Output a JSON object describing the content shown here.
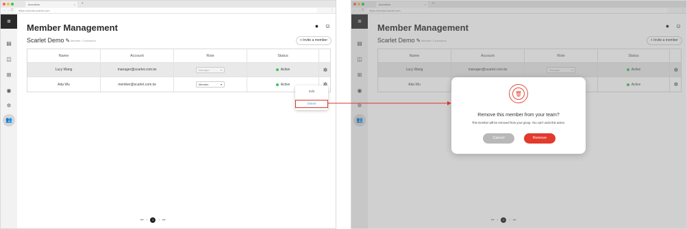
{
  "browser": {
    "tab_title": "docmArts",
    "tab_close": "×",
    "new_tab": "+",
    "url": "https://vendor.scarlet.com",
    "nav_back": "←",
    "nav_forward": "→",
    "nav_reload": "C",
    "menu": "⋮",
    "dot_colors": [
      "#ff5f57",
      "#febc2e",
      "#28c840"
    ]
  },
  "sidebar": {
    "menu_icon": "≡",
    "items": [
      {
        "icon": "documents-icon",
        "glyph": "▤"
      },
      {
        "icon": "dashboard-icon",
        "glyph": "◫"
      },
      {
        "icon": "organization-icon",
        "glyph": "⊞"
      },
      {
        "icon": "visibility-icon",
        "glyph": "◉"
      },
      {
        "icon": "settings-icon",
        "glyph": "✲"
      },
      {
        "icon": "members-icon",
        "glyph": "👥",
        "active": true
      }
    ]
  },
  "header": {
    "title": "Member Management",
    "notification_glyph": "●",
    "profile_glyph": "☺"
  },
  "group": {
    "name": "Scarlet Demo",
    "edit_glyph": "✎",
    "member_count": "Member: 2 members",
    "invite_label": "+ Invite a member"
  },
  "table": {
    "headers": [
      "Name",
      "Account",
      "Role",
      "Status"
    ],
    "rows": [
      {
        "name": "Lucy Wang",
        "account": "manager@scarlet.com.tw",
        "role": "Manager",
        "status": "Active"
      },
      {
        "name": "Ada Wu",
        "account": "member@scarlet.com.tw",
        "role": "Member",
        "status": "Active"
      }
    ],
    "caret": "▾",
    "gear_glyph": "✲"
  },
  "row_menu": {
    "edit_label": "Edit",
    "delete_label": "Delete"
  },
  "pagination": {
    "first": "⏮",
    "prev": "‹",
    "current": "1",
    "next": "›",
    "last": "⏭"
  },
  "modal": {
    "trash_glyph": "🗑",
    "title": "Remove this member from your team?",
    "description": "This member will be removed from your group. You can't undo this action.",
    "cancel_label": "Cancel",
    "remove_label": "Remove"
  },
  "colors": {
    "active_status": "#34c759",
    "accent_red": "#e23a2c",
    "delete_link": "#4aa3d8",
    "sidebar_dark": "#2a2a2a"
  }
}
